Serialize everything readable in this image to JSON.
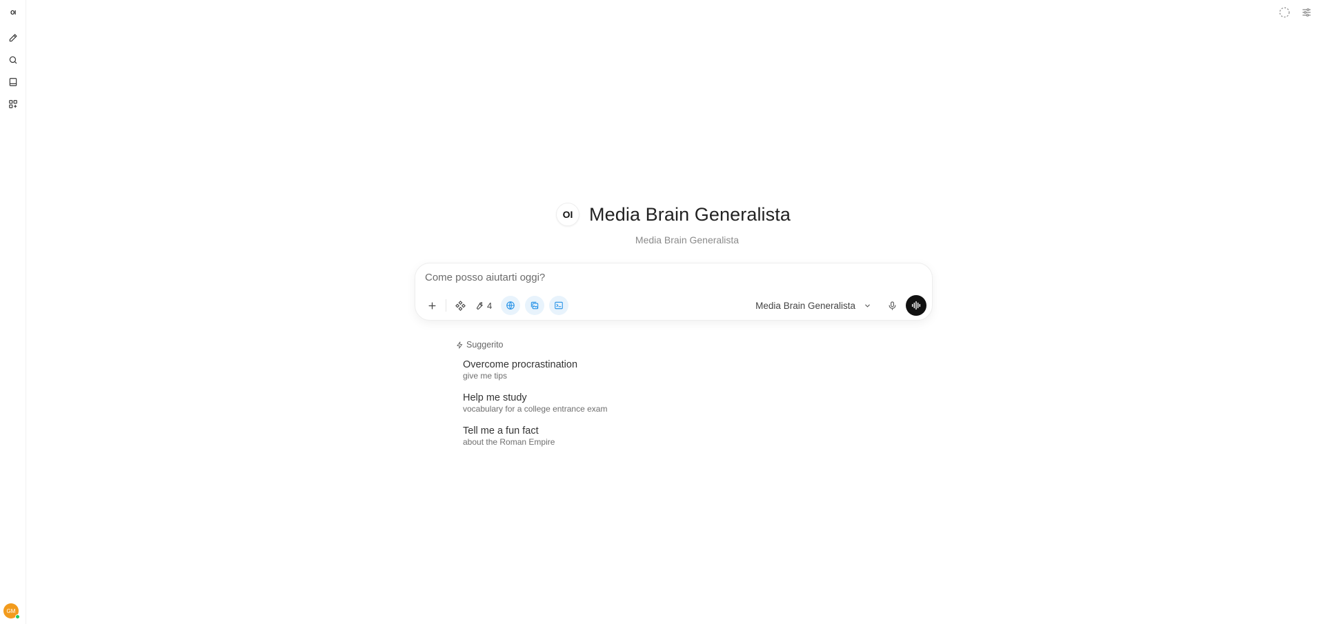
{
  "sidebar": {
    "logo": "OI",
    "avatar_initials": "GM",
    "icons": [
      "pencil-icon",
      "search-icon",
      "notebook-icon",
      "apps-grid-icon"
    ]
  },
  "model": {
    "logo": "OI",
    "title": "Media Brain Generalista",
    "subtitle": "Media Brain Generalista"
  },
  "composer": {
    "placeholder": "Come posso aiutarti oggi?",
    "tools_count": "4",
    "selected_model": "Media Brain Generalista"
  },
  "suggestions": {
    "header": "Suggerito",
    "items": [
      {
        "title": "Overcome procrastination",
        "subtitle": "give me tips"
      },
      {
        "title": "Help me study",
        "subtitle": "vocabulary for a college entrance exam"
      },
      {
        "title": "Tell me a fun fact",
        "subtitle": "about the Roman Empire"
      }
    ]
  },
  "colors": {
    "accent_blue": "#1e8ee6",
    "avatar": "#f29b1d",
    "online": "#22c55e",
    "voice_button": "#111111"
  }
}
